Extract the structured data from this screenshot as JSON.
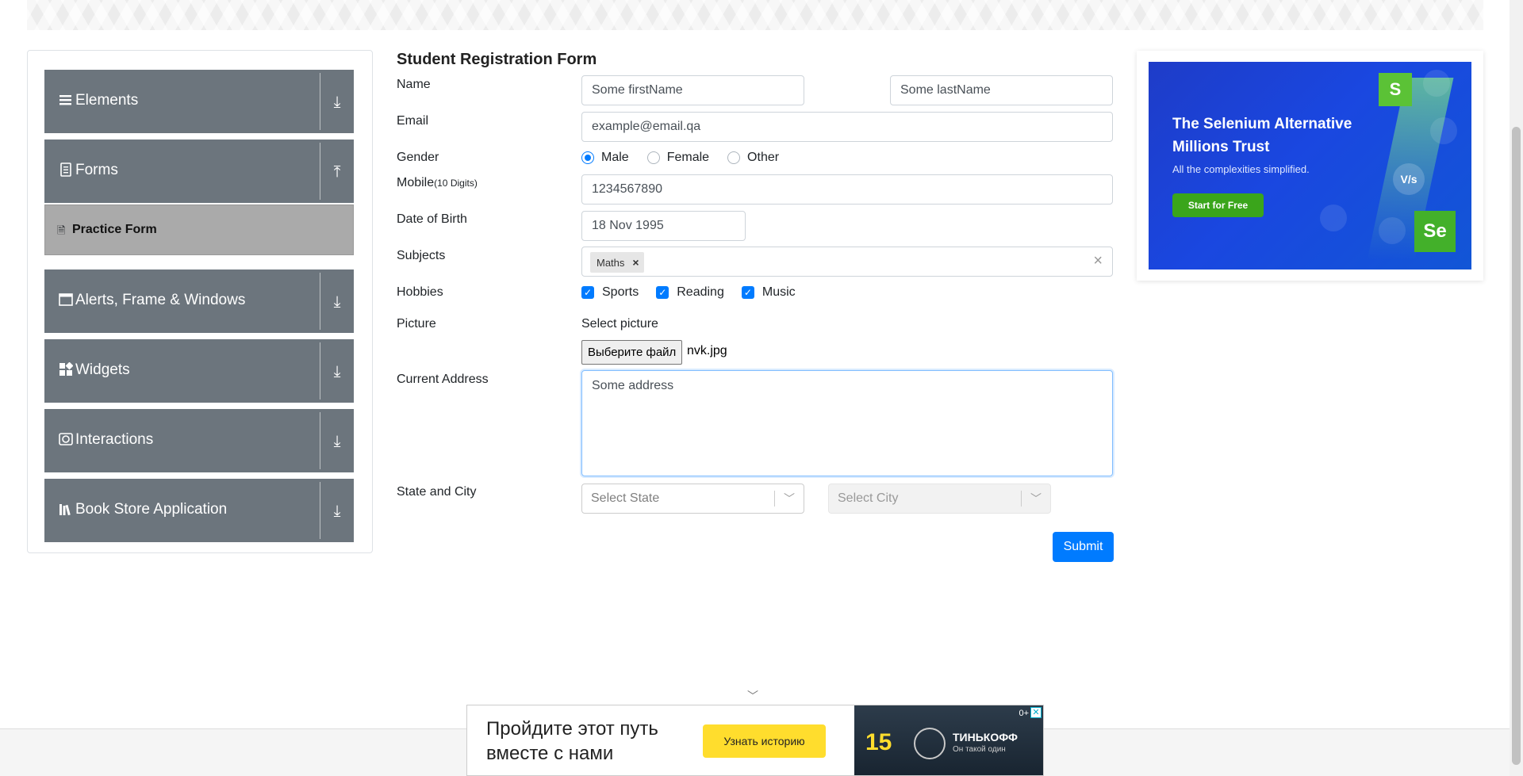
{
  "sidebar": {
    "groups": [
      {
        "label": "Elements",
        "icon": "list-icon",
        "arrow": "⤓"
      },
      {
        "label": "Forms",
        "icon": "document-icon",
        "arrow": "⤒"
      },
      {
        "label": "Alerts, Frame & Windows",
        "icon": "window-icon",
        "arrow": "⤓"
      },
      {
        "label": "Widgets",
        "icon": "widgets-icon",
        "arrow": "⤓"
      },
      {
        "label": "Interactions",
        "icon": "interaction-icon",
        "arrow": "⤓"
      },
      {
        "label": "Book Store Application",
        "icon": "books-icon",
        "arrow": "⤓"
      }
    ],
    "active_item": "Practice Form"
  },
  "form": {
    "title": "Student Registration Form",
    "labels": {
      "name": "Name",
      "email": "Email",
      "gender": "Gender",
      "mobile": "Mobile",
      "mobile_hint": "(10 Digits)",
      "dob": "Date of Birth",
      "subjects": "Subjects",
      "hobbies": "Hobbies",
      "picture": "Picture",
      "address": "Current Address",
      "state_city": "State and City"
    },
    "first_name": "Some firstName",
    "last_name": "Some lastName",
    "email": "example@email.qa",
    "genders": [
      "Male",
      "Female",
      "Other"
    ],
    "selected_gender": "Male",
    "mobile": "1234567890",
    "dob": "18 Nov 1995",
    "subject_chip": "Maths",
    "hobbies": [
      "Sports",
      "Reading",
      "Music"
    ],
    "picture_caption": "Select picture",
    "file_button": "Выберите файл",
    "file_name": "nvk.jpg",
    "address": "Some address",
    "state_placeholder": "Select State",
    "city_placeholder": "Select City",
    "submit": "Submit"
  },
  "ad_right": {
    "headline": "The Selenium Alternative Millions Trust",
    "sub": "All the complexities simplified.",
    "cta": "Start for Free",
    "logo_s": "S",
    "logo_se": "Se",
    "vs": "V/s"
  },
  "ad_bottom": {
    "text": "Пройдите этот путь вместе с нами",
    "cta": "Узнать историю",
    "age": "0+",
    "years": "15",
    "brand": "ТИНЬКОФФ",
    "slogan": "Он такой один",
    "close": "✕"
  },
  "colors": {
    "accent": "#007bff",
    "sidebar_group": "#6c757d",
    "active_item": "#aaaaaa",
    "ad_cta_yellow": "#ffdd2d"
  }
}
